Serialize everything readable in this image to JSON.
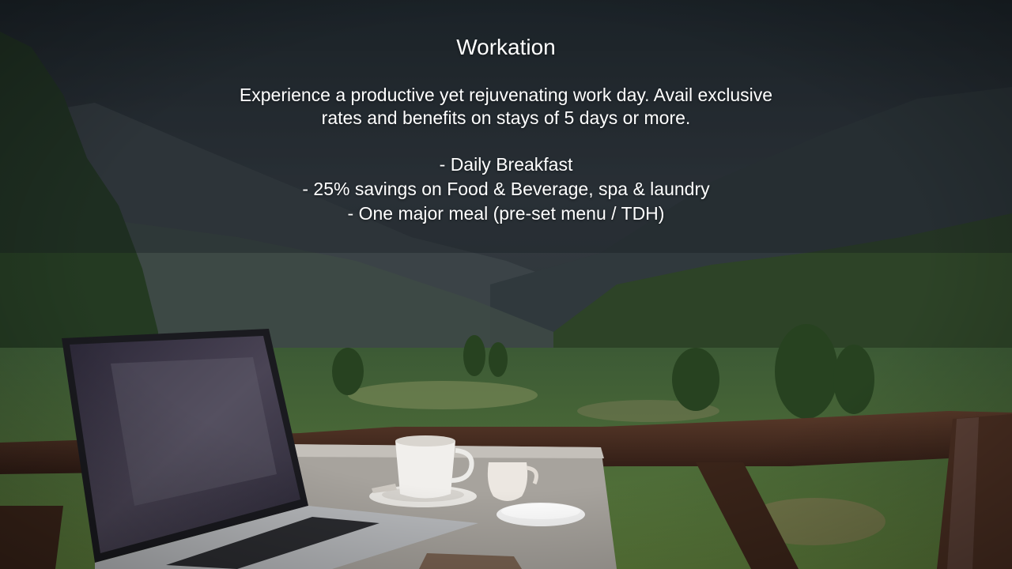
{
  "promo": {
    "title": "Workation",
    "description_lines": [
      "Experience a productive yet rejuvenating work day. Avail exclusive",
      "rates and benefits on stays of 5 days or more."
    ],
    "benefits": [
      "- Daily Breakfast",
      "- 25% savings on Food & Beverage, spa & laundry",
      "- One major meal (pre-set menu / TDH)"
    ]
  },
  "scene": {
    "subject": "laptop-with-coffee-on-balcony-overlooking-mountains",
    "colors": {
      "sky": "#2b3238",
      "mountain_far": "#3a4248",
      "forest": "#2f4a2a",
      "railing": "#4a2e22",
      "table": "#a9a49d"
    }
  }
}
